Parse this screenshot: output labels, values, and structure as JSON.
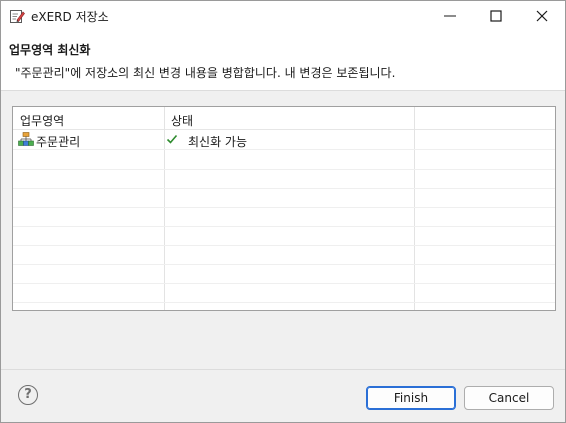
{
  "window": {
    "title": "eXERD 저장소",
    "icons": {
      "app": "edit-note-icon",
      "minimize": "minimize-icon",
      "maximize": "maximize-icon",
      "close": "close-icon"
    }
  },
  "header": {
    "title": "업무영역 최신화",
    "message": "\"주문관리\"에 저장소의 최신 변경 내용을 병합합니다. 내 변경은 보존됩니다."
  },
  "table": {
    "columns": [
      "업무영역",
      "상태"
    ],
    "rows": [
      {
        "area": "주문관리",
        "area_icon": "group-tree-icon",
        "status": "최신화 가능",
        "status_icon": "check-icon"
      }
    ],
    "empty_rows": 8
  },
  "footer": {
    "help_label": "?",
    "finish_label": "Finish",
    "cancel_label": "Cancel"
  },
  "colors": {
    "check": "#2e8b2e",
    "primary_border": "#2a6fd6"
  }
}
